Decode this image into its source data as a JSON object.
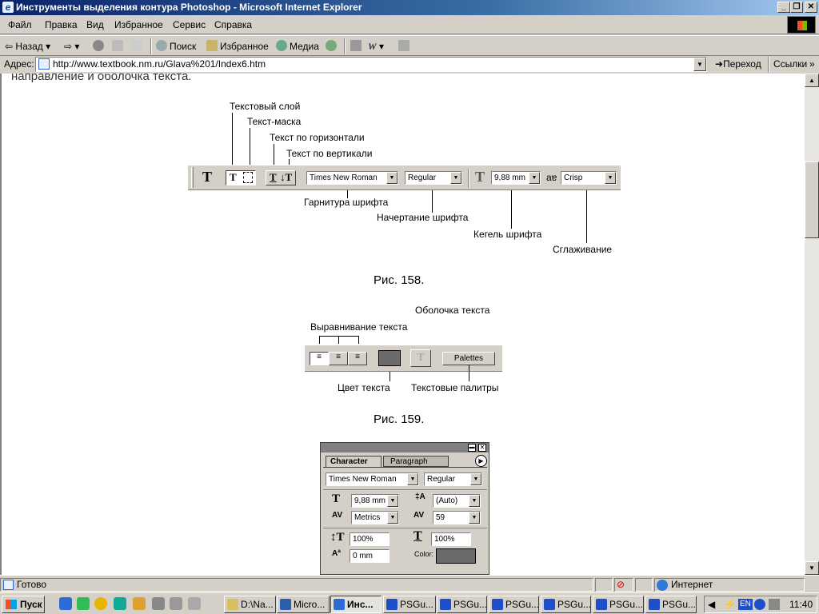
{
  "window": {
    "title": "Инструменты выделения контура Photoshop - Microsoft Internet Explorer"
  },
  "menu": [
    "Файл",
    "Правка",
    "Вид",
    "Избранное",
    "Сервис",
    "Справка"
  ],
  "toolbar": {
    "back": "Назад",
    "search": "Поиск",
    "favorites": "Избранное",
    "media": "Медиа"
  },
  "address": {
    "label": "Адрес:",
    "url": "http://www.textbook.nm.ru/Glava%201/Index6.htm",
    "go": "Переход",
    "links": "Ссылки"
  },
  "content": {
    "top_text": "направление и оболочка текста.",
    "fig158": {
      "labels": [
        "Текстовый слой",
        "Текст-маска",
        "Текст по горизонтали",
        "Текст по вертикали",
        "Гарнитура шрифта",
        "Начертание шрифта",
        "Кегель шрифта",
        "Сглаживание"
      ],
      "font": "Times New Roman",
      "style": "Regular",
      "size": "9,88 mm",
      "aa_label": "aɐ",
      "aa": "Crisp",
      "caption": "Рис. 158."
    },
    "fig159": {
      "labels": [
        "Оболочка текста",
        "Выравнивание текста",
        "Цвет текста",
        "Текстовые палитры"
      ],
      "palettes": "Palettes",
      "caption": "Рис. 159."
    },
    "panel": {
      "tab1": "Character",
      "tab2": "Paragraph",
      "font": "Times New Roman",
      "style": "Regular",
      "size": "9,88 mm",
      "leading": "(Auto)",
      "kerning": "Metrics",
      "tracking": "59",
      "vscale": "100%",
      "hscale": "100%",
      "baseline": "0 mm",
      "color_label": "Color:"
    }
  },
  "status": {
    "text": "Готово",
    "zone": "Интернет"
  },
  "taskbar": {
    "start": "Пуск",
    "tasks": [
      "D:\\Na...",
      "Micro...",
      "Инс...",
      "PSGu...",
      "PSGu...",
      "PSGu...",
      "PSGu...",
      "PSGu...",
      "PSGu..."
    ],
    "lang": "EN",
    "clock": "11:40"
  },
  "colors": {
    "title_start": "#0a246a",
    "title_end": "#a6caf0",
    "face": "#d4d0c8",
    "swatch": "#6b6b6b"
  }
}
